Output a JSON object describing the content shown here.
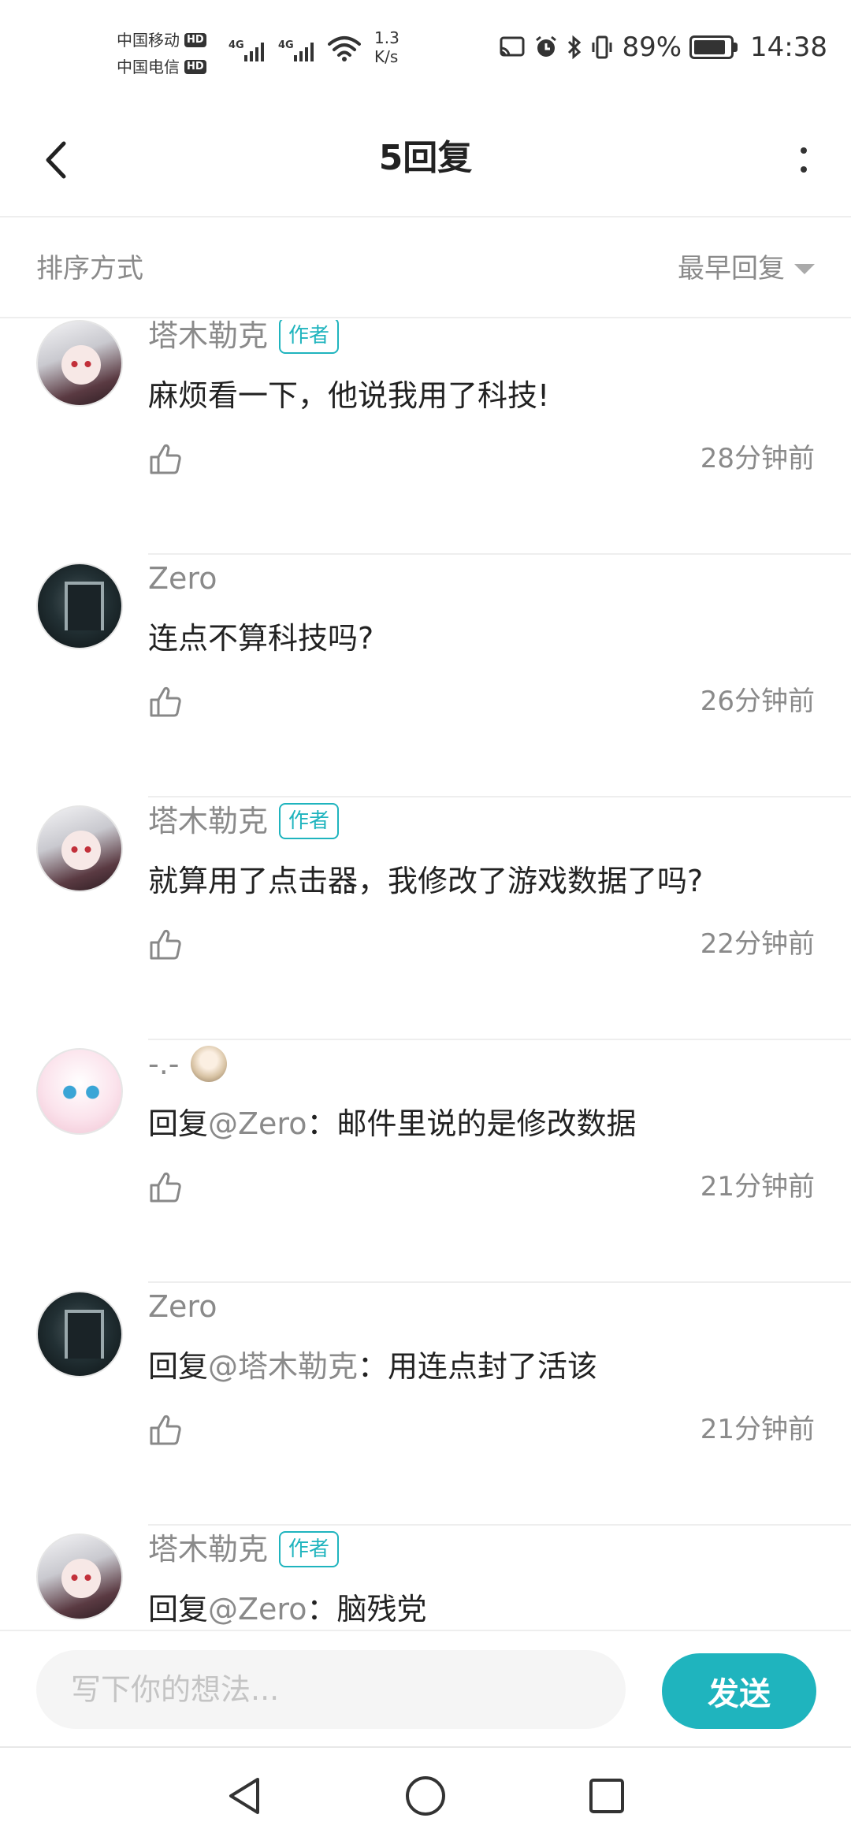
{
  "status_bar": {
    "carrier_1": "中国移动",
    "carrier_2": "中国电信",
    "hd": "HD",
    "network": "4G",
    "speed_value": "1.3",
    "speed_unit": "K/s",
    "battery": "89%",
    "battery_level": 0.89,
    "time": "14:38"
  },
  "header": {
    "title": "5回复"
  },
  "sort": {
    "label": "排序方式",
    "selected": "最早回复"
  },
  "replies": [
    {
      "user": "塔木勒克",
      "badge": "作者",
      "avatar": "silver",
      "mention_prefix": "",
      "mention": "",
      "text": "麻烦看一下，他说我用了科技!",
      "time": "28分钟前"
    },
    {
      "user": "Zero",
      "badge": "",
      "avatar": "dark",
      "mention_prefix": "",
      "mention": "",
      "text": "连点不算科技吗?",
      "time": "26分钟前"
    },
    {
      "user": "塔木勒克",
      "badge": "作者",
      "avatar": "silver",
      "mention_prefix": "",
      "mention": "",
      "text": "就算用了点击器，我修改了游戏数据了吗?",
      "time": "22分钟前"
    },
    {
      "user": "-.-",
      "badge": "",
      "avatar": "pink",
      "mention_prefix": "回复",
      "mention": "@Zero",
      "text": "：邮件里说的是修改数据",
      "time": "21分钟前"
    },
    {
      "user": "Zero",
      "badge": "",
      "avatar": "dark",
      "mention_prefix": "回复",
      "mention": "@塔木勒克",
      "text": "：用连点封了活该",
      "time": "21分钟前"
    },
    {
      "user": "塔木勒克",
      "badge": "作者",
      "avatar": "silver",
      "mention_prefix": "回复",
      "mention": "@Zero",
      "text": "：脑残党",
      "time": ""
    }
  ],
  "input": {
    "placeholder": "写下你的想法...",
    "send_label": "发送"
  },
  "colors": {
    "accent": "#1fb4be",
    "muted_text": "#8a8a8a",
    "divider": "#eeeeee"
  },
  "icons": {
    "back": "chevron-left-icon",
    "more": "more-vertical-icon",
    "like": "thumbs-up-icon",
    "nav_back": "triangle-back-icon",
    "nav_home": "circle-home-icon",
    "nav_recent": "square-recent-icon"
  }
}
